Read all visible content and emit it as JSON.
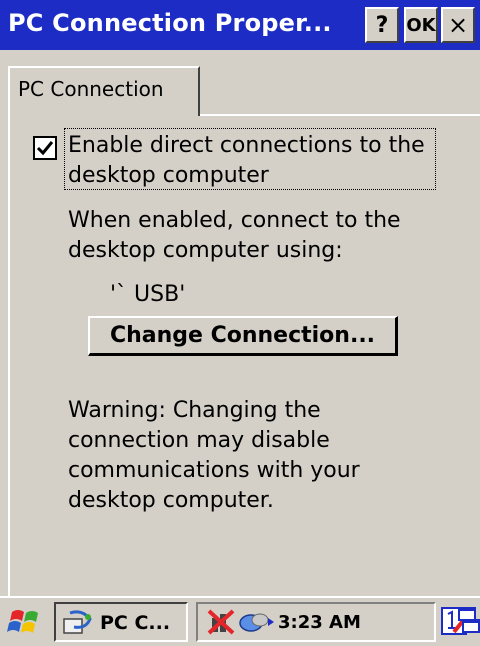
{
  "window": {
    "title": "PC Connection Proper...",
    "help_label": "?",
    "ok_label": "OK",
    "close_label": "×"
  },
  "tabs": [
    {
      "label": "PC Connection",
      "selected": true
    }
  ],
  "content": {
    "checkbox_label": "Enable direct connections to the desktop computer",
    "checkbox_checked": true,
    "description": "When enabled, connect to the desktop computer using:",
    "connection_value": "'` USB'",
    "change_button_label": "Change Connection...",
    "warning": "Warning: Changing the connection may disable communications with your desktop computer."
  },
  "taskbar": {
    "start_icon": "windows-flag-icon",
    "task_label": "PC C...",
    "task_icon": "pc-connection-app-icon",
    "clock": "3:23 AM",
    "tray_icons": [
      "network-disconnected-icon",
      "activesync-icon",
      "input-panel-icon",
      "desktop-switch-icon"
    ]
  },
  "colors": {
    "titlebar": "#1d2cc4",
    "face": "#d4d0c8"
  }
}
